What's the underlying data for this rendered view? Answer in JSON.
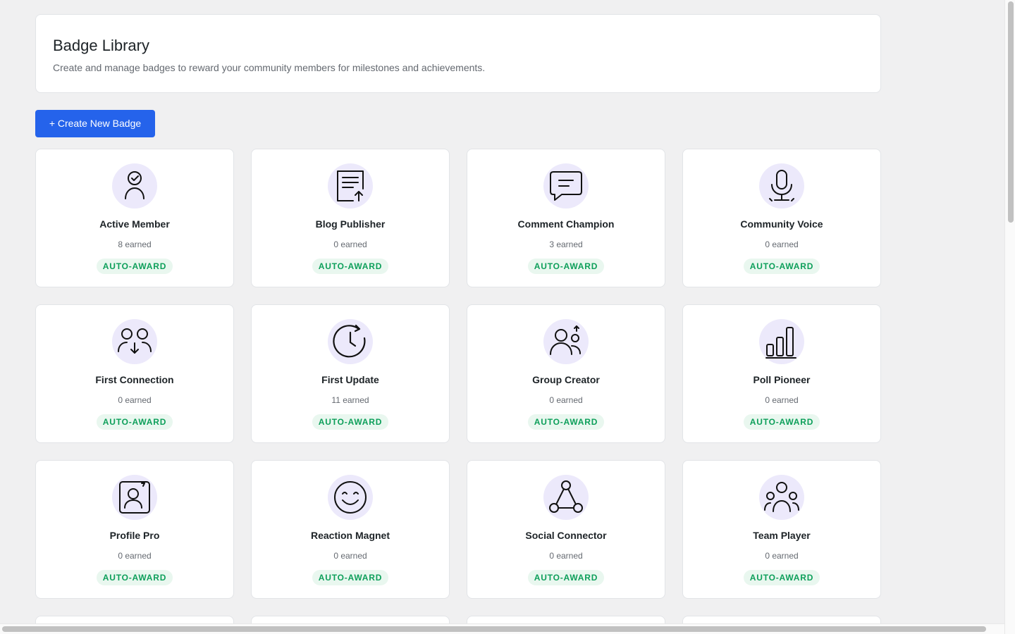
{
  "header": {
    "title": "Badge Library",
    "description": "Create and manage badges to reward your community members for milestones and achievements."
  },
  "actions": {
    "create_label": "+ Create New Badge"
  },
  "colors": {
    "primary": "#2563eb",
    "icon_bg": "#ece9fb",
    "tag_bg": "#e9f7ef",
    "tag_text": "#0d9f5a"
  },
  "badges": [
    {
      "name": "Active Member",
      "earned": "8 earned",
      "tag": "AUTO-AWARD",
      "icon": "user-check-icon"
    },
    {
      "name": "Blog Publisher",
      "earned": "0 earned",
      "tag": "AUTO-AWARD",
      "icon": "document-upload-icon"
    },
    {
      "name": "Comment Champion",
      "earned": "3 earned",
      "tag": "AUTO-AWARD",
      "icon": "chat-bubble-icon"
    },
    {
      "name": "Community Voice",
      "earned": "0 earned",
      "tag": "AUTO-AWARD",
      "icon": "microphone-icon"
    },
    {
      "name": "First Connection",
      "earned": "0 earned",
      "tag": "AUTO-AWARD",
      "icon": "connect-users-icon"
    },
    {
      "name": "First Update",
      "earned": "11 earned",
      "tag": "AUTO-AWARD",
      "icon": "clock-refresh-icon"
    },
    {
      "name": "Group Creator",
      "earned": "0 earned",
      "tag": "AUTO-AWARD",
      "icon": "group-add-icon"
    },
    {
      "name": "Poll Pioneer",
      "earned": "0 earned",
      "tag": "AUTO-AWARD",
      "icon": "bar-chart-icon"
    },
    {
      "name": "Profile Pro",
      "earned": "0 earned",
      "tag": "AUTO-AWARD",
      "icon": "profile-card-icon"
    },
    {
      "name": "Reaction Magnet",
      "earned": "0 earned",
      "tag": "AUTO-AWARD",
      "icon": "smiley-icon"
    },
    {
      "name": "Social Connector",
      "earned": "0 earned",
      "tag": "AUTO-AWARD",
      "icon": "network-icon"
    },
    {
      "name": "Team Player",
      "earned": "0 earned",
      "tag": "AUTO-AWARD",
      "icon": "team-icon"
    }
  ]
}
